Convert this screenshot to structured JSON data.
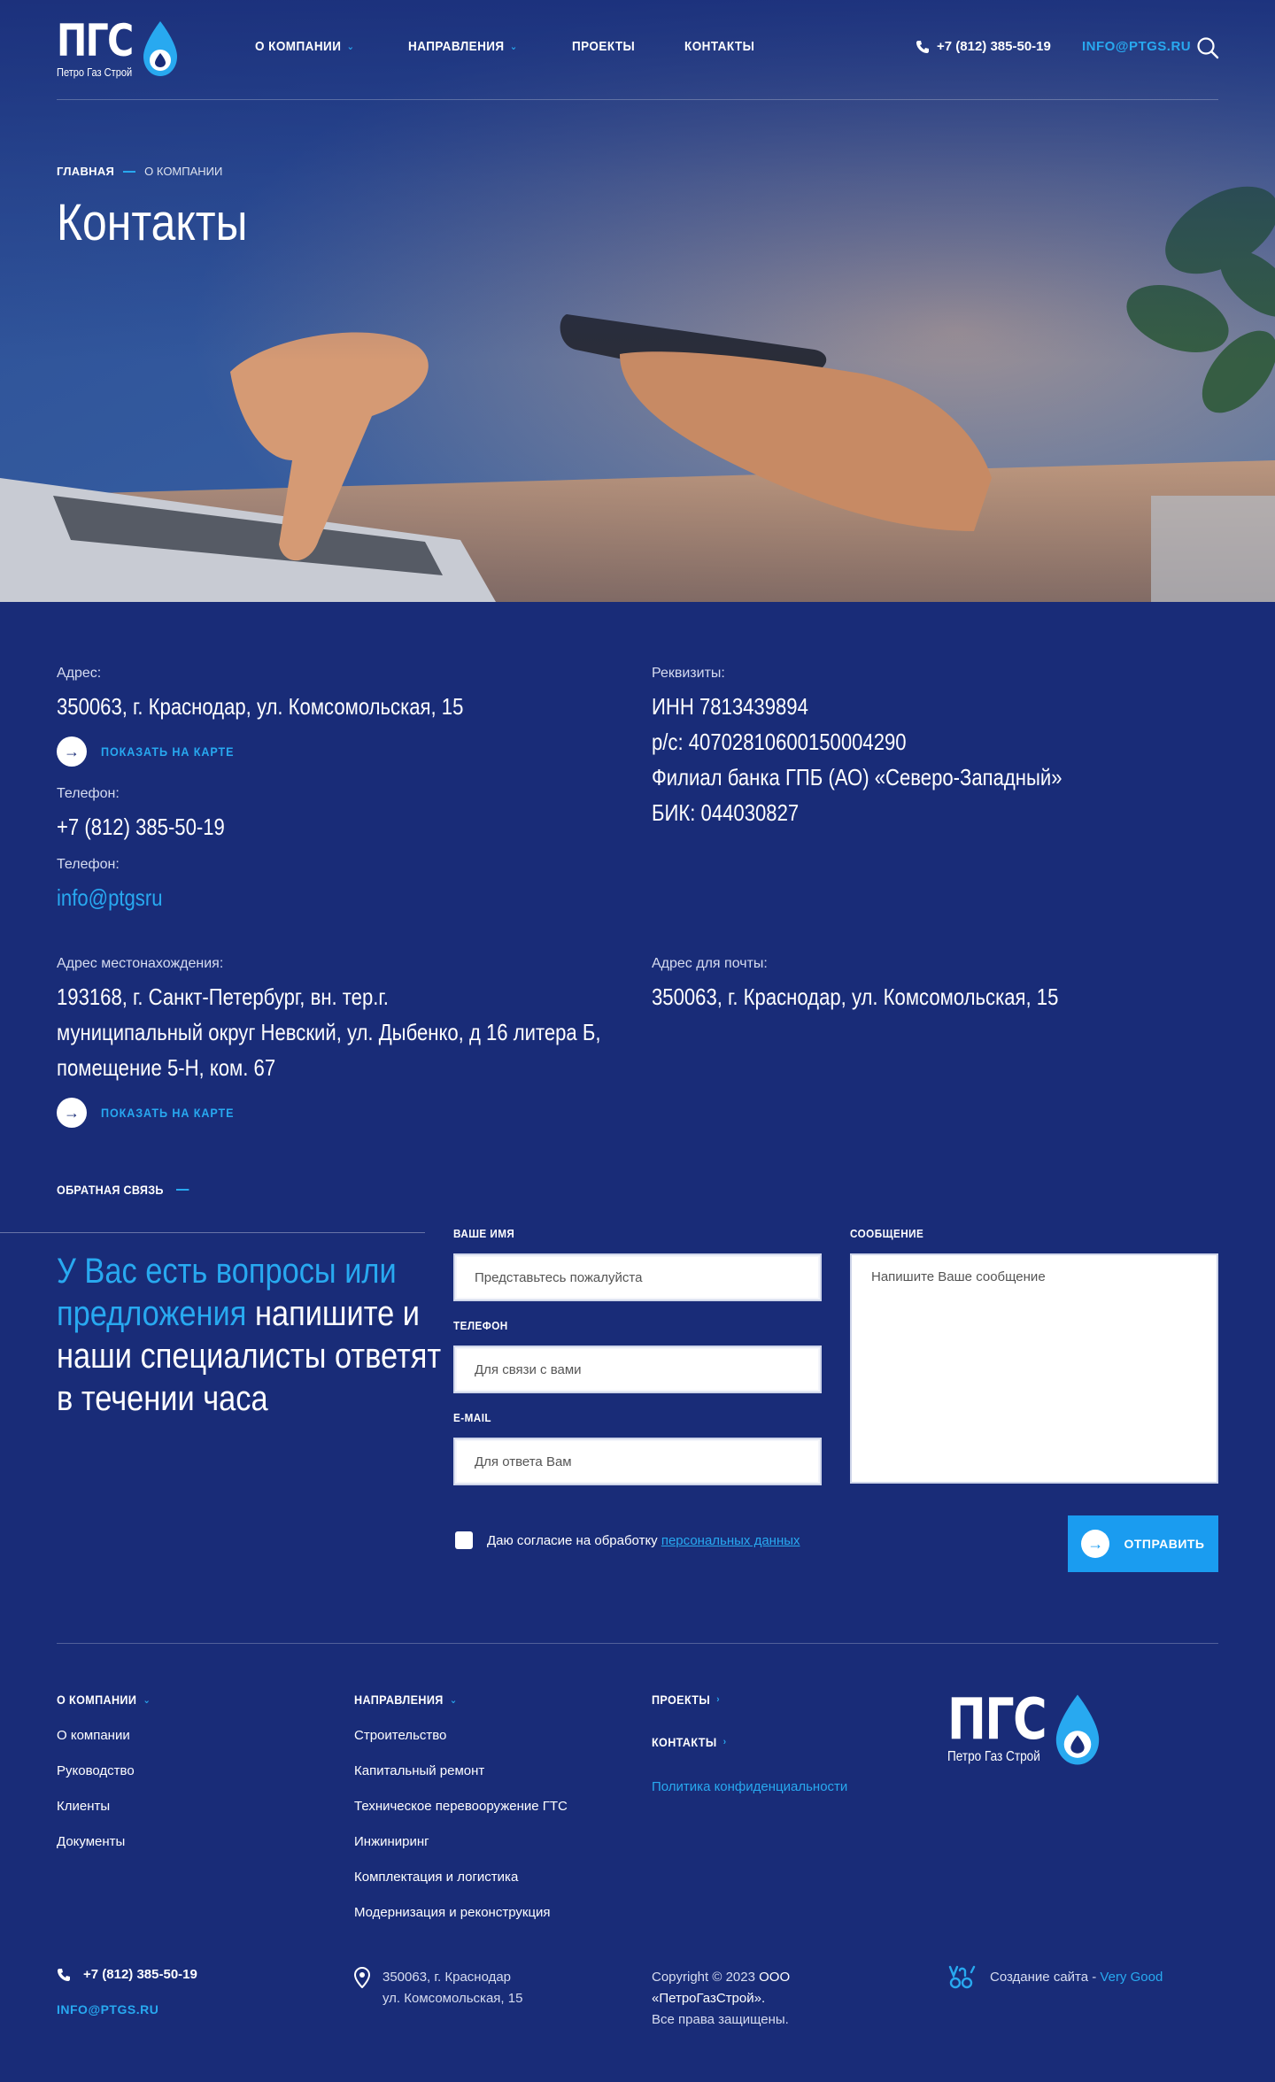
{
  "brand": {
    "logo_text": "ПГС",
    "logo_sub": "Петро Газ Строй",
    "accent": "#28a9f0",
    "background": "#192c78"
  },
  "header": {
    "nav": [
      {
        "label": "О КОМПАНИИ",
        "has_dropdown": true
      },
      {
        "label": "НАПРАВЛЕНИЯ",
        "has_dropdown": true
      },
      {
        "label": "ПРОЕКТЫ",
        "has_dropdown": false
      },
      {
        "label": "КОНТАКТЫ",
        "has_dropdown": false
      }
    ],
    "phone": "+7 (812) 385-50-19",
    "email": "INFO@PTGS.RU",
    "search_icon": "search-icon"
  },
  "breadcrumb": {
    "home": "ГЛАВНАЯ",
    "current": "О КОМПАНИИ"
  },
  "page_title": "Контакты",
  "contacts": {
    "address_label": "Адрес:",
    "address": "350063, г. Краснодар, ул. Комсомольская, 15",
    "map_link": "ПОКАЗАТЬ НА КАРТЕ",
    "phone_label": "Телефон:",
    "phone": "+7 (812) 385-50-19",
    "email_label": "Телефон:",
    "email": "info@ptgsru",
    "requisites_label": "Реквизиты:",
    "requisites": [
      "ИНН 7813439894",
      "р/с: 40702810600150004290",
      "Филиал банка ГПБ (АО)  «Северо-Западный»",
      "БИК: 044030827"
    ],
    "location_label": "Адрес местонахождения:",
    "location": [
      "193168, г. Санкт-Петербург, вн. тер.г.",
      "муниципальный округ Невский, ул. Дыбенко, д 16 литера Б,",
      "помещение 5-Н, ком. 67"
    ],
    "postal_label": "Адрес для почты:",
    "postal": "350063, г. Краснодар, ул. Комсомольская, 15"
  },
  "feedback": {
    "section_label": "ОБРАТНАЯ СВЯЗЬ",
    "heading_highlight": "У Вас есть вопросы или предложения",
    "heading_rest": " напишите и наши специалисты ответят в течении часа",
    "name_label": "ВАШЕ ИМЯ",
    "name_placeholder": "Представьтесь пожалуйста",
    "phone_label": "ТЕЛЕФОН",
    "phone_placeholder": "Для связи с вами",
    "email_label": "E-MAIL",
    "email_placeholder": "Для ответа Вам",
    "message_label": "СООБЩЕНИЕ",
    "message_placeholder": "Напишите Ваше сообщение",
    "consent_text": "Даю согласие на обработку ",
    "consent_link": "персональных данных",
    "submit": "ОТПРАВИТЬ"
  },
  "footer": {
    "col1": {
      "head": "О КОМПАНИИ",
      "links": [
        "О компании",
        "Руководство",
        "Клиенты",
        "Документы"
      ]
    },
    "col2": {
      "head": "НАПРАВЛЕНИЯ",
      "links": [
        "Строительство",
        "Капитальный ремонт",
        "Техническое перевооружение ГТС",
        "Инжиниринг",
        "Комплектация и логистика",
        "Модернизация и реконструкция"
      ]
    },
    "col3": {
      "projects": "ПРОЕКТЫ",
      "contacts": "КОНТАКТЫ",
      "policy": "Политика конфиденциальности"
    },
    "phone": "+7 (812) 385-50-19",
    "email": "INFO@PTGS.RU",
    "address_line1": "350063, г. Краснодар",
    "address_line2": "ул. Комсомольская, 15",
    "copy_line1_a": "Copyright © 2023 ",
    "copy_line1_b": "ООО",
    "copy_line2": "«ПетроГазСтрой».",
    "copy_line3": "Все права защищены.",
    "credit_text": "Создание сайта - ",
    "credit_link": "Very Good"
  }
}
